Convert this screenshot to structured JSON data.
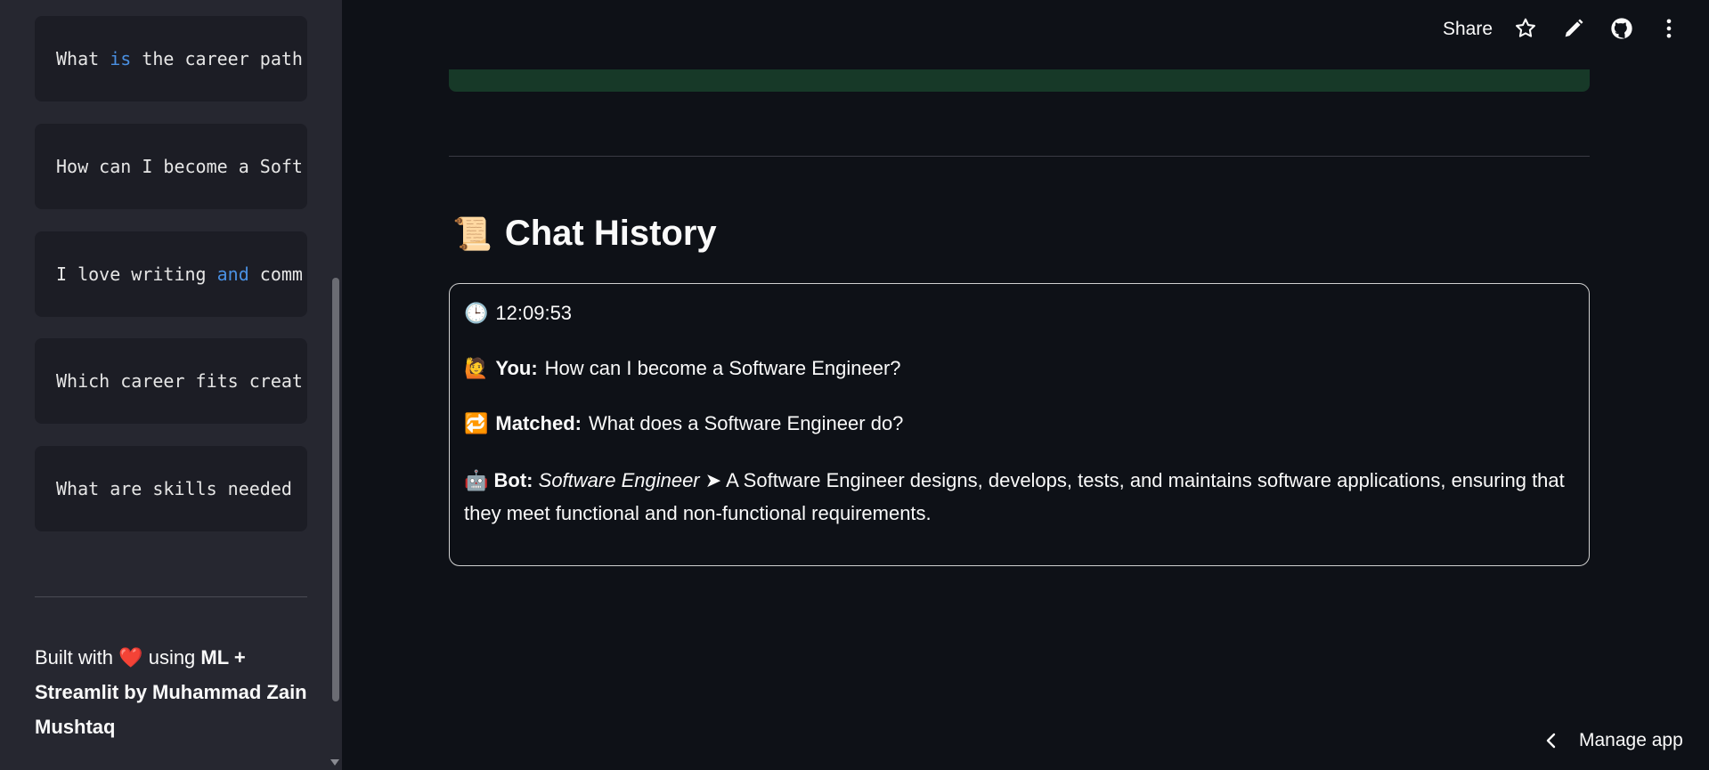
{
  "sidebar": {
    "code_blocks": [
      {
        "parts": [
          {
            "t": "What ",
            "k": false
          },
          {
            "t": "is",
            "k": true
          },
          {
            "t": " the career path",
            "k": false
          }
        ]
      },
      {
        "parts": [
          {
            "t": "How can I become a Soft",
            "k": false
          }
        ]
      },
      {
        "parts": [
          {
            "t": "I love writing ",
            "k": false
          },
          {
            "t": "and",
            "k": true
          },
          {
            "t": " comm",
            "k": false
          }
        ]
      },
      {
        "parts": [
          {
            "t": "Which career fits creat",
            "k": false
          }
        ]
      },
      {
        "parts": [
          {
            "t": "What are skills needed ",
            "k": false
          }
        ]
      }
    ],
    "footer": {
      "prefix": "Built with",
      "heart": "❤️",
      "middle": "using",
      "bold": "ML + Streamlit by Muhammad Zain Mushtaq"
    }
  },
  "toolbar": {
    "share_label": "Share",
    "icons": [
      "star-icon",
      "pencil-icon",
      "github-icon",
      "more-vertical-icon"
    ]
  },
  "main": {
    "heading_emoji": "📜",
    "heading": "Chat History",
    "chat": {
      "time_emoji": "🕒",
      "time": "12:09:53",
      "you_emoji": "🙋",
      "you_label": "You:",
      "you_text": "How can I become a Software Engineer?",
      "matched_emoji": "🔁",
      "matched_label": "Matched:",
      "matched_text": "What does a Software Engineer do?",
      "bot_emoji": "🤖",
      "bot_label": "Bot:",
      "bot_career": "Software Engineer",
      "bot_arrow": "➤",
      "bot_text": "A Software Engineer designs, develops, tests, and maintains software applications, ensuring that they meet functional and non-functional requirements."
    }
  },
  "manage_app": {
    "label": "Manage app"
  },
  "colors": {
    "background": "#0e1117",
    "sidebar": "#262730",
    "keyword": "#4a90e2",
    "banner": "#173928"
  }
}
